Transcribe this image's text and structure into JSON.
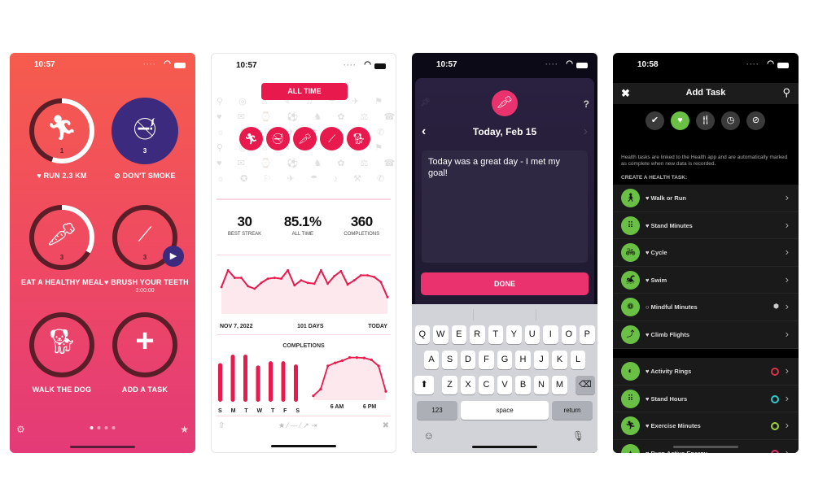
{
  "panel1": {
    "status_time": "10:57",
    "tiles": [
      {
        "label": "RUN 2.3 KM",
        "prefix_icon": "heart-icon",
        "count": "1",
        "icon": "running-person-icon",
        "progress": 0.55,
        "style": "ring"
      },
      {
        "label": "DON'T SMOKE",
        "prefix_icon": "prohibited-icon",
        "count": "3",
        "icon": "no-smoking-icon",
        "progress": 1.0,
        "style": "filled"
      },
      {
        "label": "EAT A HEALTHY MEAL",
        "count": "3",
        "icon": "carrot-icon",
        "progress": 0.33,
        "style": "ring"
      },
      {
        "label": "BRUSH YOUR TEETH",
        "prefix_icon": "heart-icon",
        "count": "3",
        "sub": "3:00:00",
        "icon": "toothbrush-icon",
        "progress": 0.0,
        "style": "ring"
      },
      {
        "label": "WALK THE DOG",
        "icon": "dog-icon",
        "progress": 0.0,
        "style": "ring"
      },
      {
        "label": "ADD A TASK",
        "icon": "plus-icon",
        "progress": 0.0,
        "style": "ring"
      }
    ],
    "page_count": 4,
    "active_page": 1,
    "colors": {
      "gradient_top": "#f65c4d",
      "gradient_bottom": "#e43a78",
      "filled": "#3b2a7e",
      "ring_track": "#5a1e28"
    }
  },
  "panel2": {
    "status_time": "10:57",
    "range_button": "ALL TIME",
    "habit_icons": [
      "running-person-icon",
      "no-smoking-icon",
      "carrot-icon",
      "toothbrush-icon",
      "dog-icon"
    ],
    "stats": [
      {
        "value": "30",
        "label": "BEST STREAK"
      },
      {
        "value": "85.1%",
        "label": "ALL TIME"
      },
      {
        "value": "360",
        "label": "COMPLETIONS"
      }
    ],
    "trend": {
      "start_label": "NOV 7, 2022",
      "mid_label": "101 DAYS",
      "end_label": "TODAY",
      "values": [
        72,
        92,
        83,
        83,
        73,
        70,
        77,
        82,
        83,
        82,
        92,
        74,
        80,
        77,
        76,
        92,
        76,
        85,
        91,
        75,
        80,
        86,
        86,
        84,
        78,
        60
      ]
    },
    "completions_title": "COMPLETIONS",
    "weekday": {
      "labels": [
        "S",
        "M",
        "T",
        "W",
        "T",
        "F",
        "S"
      ],
      "values": [
        82,
        100,
        100,
        77,
        86,
        86,
        79
      ]
    },
    "hourly": {
      "labels": [
        "6 AM",
        "6 PM"
      ],
      "values": [
        10,
        25,
        78,
        85,
        90,
        97,
        97,
        96,
        92,
        78,
        20
      ]
    },
    "accent": "#e8194d"
  },
  "panel3": {
    "status_time": "10:57",
    "title": "Today, Feb 15",
    "note_text": "Today was a great day - I met my goal!",
    "help": "?",
    "done_label": "DONE",
    "keyboard": {
      "row1": [
        "Q",
        "W",
        "E",
        "R",
        "T",
        "Y",
        "U",
        "I",
        "O",
        "P"
      ],
      "row2": [
        "A",
        "S",
        "D",
        "F",
        "G",
        "H",
        "J",
        "K",
        "L"
      ],
      "row3": [
        "Z",
        "X",
        "C",
        "V",
        "B",
        "N",
        "M"
      ],
      "numbers_label": "123",
      "space_label": "space",
      "return_label": "return"
    },
    "accent": "#e9326e"
  },
  "panel4": {
    "status_time": "10:58",
    "title": "Add Task",
    "categories": [
      {
        "icon": "checkmark-icon",
        "active": false
      },
      {
        "icon": "heart-icon",
        "active": true
      },
      {
        "icon": "fork-knife-icon",
        "active": false
      },
      {
        "icon": "clock-icon",
        "active": false
      },
      {
        "icon": "prohibited-icon",
        "active": false
      }
    ],
    "info_text": "Health tasks are linked to the Health app and are automatically marked as complete when new data is recorded.",
    "create_label": "CREATE A HEALTH TASK:",
    "tasks_group1": [
      {
        "label": "Walk or Run",
        "icon": "walking-icon",
        "prefix": "heart"
      },
      {
        "label": "Stand Minutes",
        "icon": "feet-icon",
        "prefix": "heart"
      },
      {
        "label": "Cycle",
        "icon": "bicycle-icon",
        "prefix": "heart"
      },
      {
        "label": "Swim",
        "icon": "swimmer-icon",
        "prefix": "heart"
      },
      {
        "label": "Mindful Minutes",
        "icon": "mindful-icon",
        "prefix": "circle",
        "badge": "brain-icon"
      },
      {
        "label": "Climb Flights",
        "icon": "stairs-icon",
        "prefix": "heart"
      }
    ],
    "tasks_group2": [
      {
        "label": "Activity Rings",
        "icon": "activity-icon",
        "ring_color": "#d8334a"
      },
      {
        "label": "Stand Hours",
        "icon": "feet-icon",
        "ring_color": "#35c5cf"
      },
      {
        "label": "Exercise Minutes",
        "icon": "running-person-icon",
        "ring_color": "#9ed043"
      },
      {
        "label": "Burn Active Energy",
        "icon": "flame-icon",
        "ring_color": "#e0336e"
      }
    ],
    "accent": "#6ac045"
  }
}
